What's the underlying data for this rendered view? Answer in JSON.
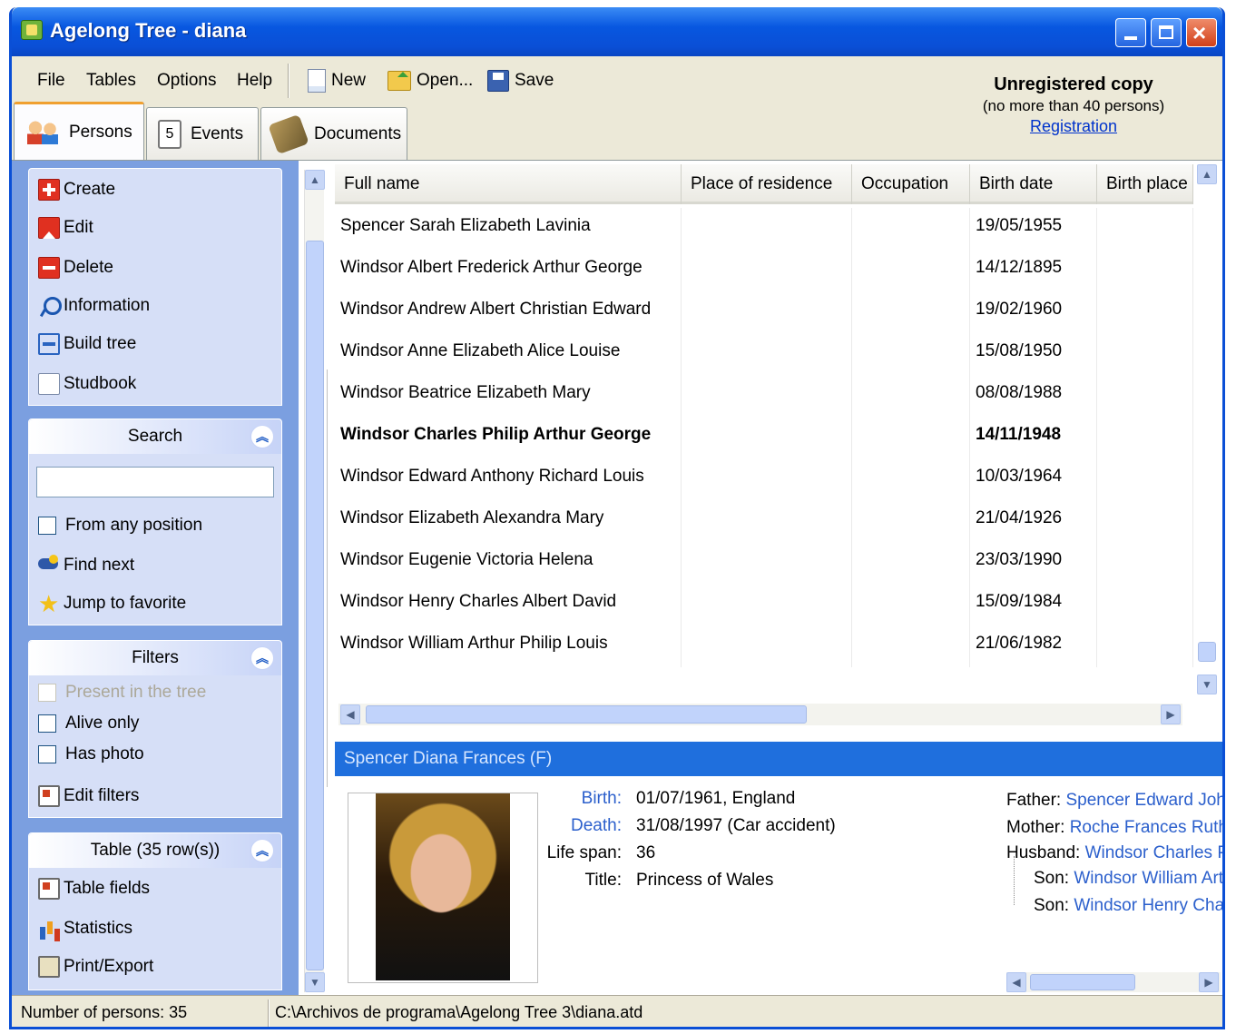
{
  "window": {
    "title": "Agelong Tree - diana"
  },
  "menu": {
    "file": "File",
    "tables": "Tables",
    "options": "Options",
    "help": "Help"
  },
  "toolbar": {
    "new": "New",
    "open": "Open...",
    "save": "Save"
  },
  "registration": {
    "title": "Unregistered copy",
    "limit": "(no more than 40 persons)",
    "link": "Registration"
  },
  "tabs": {
    "persons": "Persons",
    "events": "Events",
    "documents": "Documents",
    "events_icon_text": "5"
  },
  "actions": {
    "create": "Create",
    "edit": "Edit",
    "delete": "Delete",
    "information": "Information",
    "build_tree": "Build tree",
    "studbook": "Studbook"
  },
  "search": {
    "title": "Search",
    "value": "",
    "from_any_position": "From any position",
    "find_next": "Find next",
    "jump_to_favorite": "Jump to favorite"
  },
  "filters": {
    "title": "Filters",
    "present_in_tree": "Present in the tree",
    "alive_only": "Alive only",
    "has_photo": "Has photo",
    "edit_filters": "Edit filters"
  },
  "table_panel": {
    "title": "Table (35 row(s))",
    "table_fields": "Table fields",
    "statistics": "Statistics",
    "print_export": "Print/Export"
  },
  "grid": {
    "columns": [
      "Full name",
      "Place of residence",
      "Occupation",
      "Birth date",
      "Birth place"
    ],
    "rows": [
      {
        "name": "Spencer Sarah Elizabeth Lavinia",
        "residence": "",
        "occupation": "",
        "birth_date": "19/05/1955",
        "birth_place": ""
      },
      {
        "name": "Windsor Albert Frederick Arthur George",
        "residence": "",
        "occupation": "",
        "birth_date": "14/12/1895",
        "birth_place": ""
      },
      {
        "name": "Windsor Andrew Albert Christian Edward",
        "residence": "",
        "occupation": "",
        "birth_date": "19/02/1960",
        "birth_place": ""
      },
      {
        "name": "Windsor Anne Elizabeth Alice Louise",
        "residence": "",
        "occupation": "",
        "birth_date": "15/08/1950",
        "birth_place": ""
      },
      {
        "name": "Windsor Beatrice Elizabeth Mary",
        "residence": "",
        "occupation": "",
        "birth_date": "08/08/1988",
        "birth_place": ""
      },
      {
        "name": "Windsor Charles Philip Arthur George",
        "residence": "",
        "occupation": "",
        "birth_date": "14/11/1948",
        "birth_place": "",
        "bold": true
      },
      {
        "name": "Windsor Edward Anthony Richard Louis",
        "residence": "",
        "occupation": "",
        "birth_date": "10/03/1964",
        "birth_place": ""
      },
      {
        "name": "Windsor Elizabeth Alexandra Mary",
        "residence": "",
        "occupation": "",
        "birth_date": "21/04/1926",
        "birth_place": ""
      },
      {
        "name": "Windsor Eugenie Victoria Helena",
        "residence": "",
        "occupation": "",
        "birth_date": "23/03/1990",
        "birth_place": ""
      },
      {
        "name": "Windsor Henry Charles Albert David",
        "residence": "",
        "occupation": "",
        "birth_date": "15/09/1984",
        "birth_place": ""
      },
      {
        "name": "Windsor William Arthur Philip Louis",
        "residence": "",
        "occupation": "",
        "birth_date": "21/06/1982",
        "birth_place": ""
      }
    ]
  },
  "details": {
    "header": "Spencer Diana Frances (F)",
    "birth_label": "Birth:",
    "birth": "01/07/1961, England",
    "death_label": "Death:",
    "death": "31/08/1997 (Car accident)",
    "lifespan_label": "Life span:",
    "lifespan": "36",
    "title_label": "Title:",
    "title": "Princess of Wales",
    "father_label": "Father:",
    "father": "Spencer Edward John",
    "mother_label": "Mother:",
    "mother": "Roche Frances Ruth",
    "husband_label": "Husband:",
    "husband": "Windsor Charles Philip",
    "son1_label": "Son:",
    "son1": "Windsor William Arthur",
    "son2_label": "Son:",
    "son2": "Windsor Henry Charles"
  },
  "status": {
    "count": "Number of persons: 35",
    "path": "C:\\Archivos de programa\\Agelong Tree 3\\diana.atd"
  },
  "colors": {
    "titlebar": "#0a4fd6",
    "panel": "#7b9fe0",
    "panel_box": "#d6dff7",
    "details_header": "#1f6fdd",
    "link": "#2b5fcc"
  }
}
